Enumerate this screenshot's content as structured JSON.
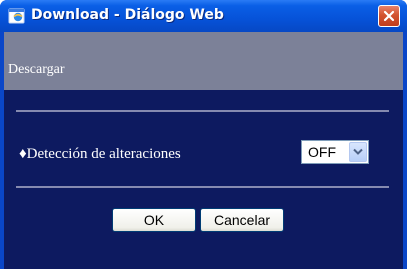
{
  "window": {
    "title": "Download - Diálogo Web",
    "close_icon": "close-icon",
    "app_icon": "browser-icon"
  },
  "section": {
    "title": "Descargar"
  },
  "field": {
    "label": "♦Detección de alteraciones",
    "select_value": "OFF",
    "select_icon": "chevron-down-icon"
  },
  "buttons": {
    "ok_label": "OK",
    "cancel_label": "Cancelar"
  },
  "colors": {
    "titlebar": "#0652d8",
    "client_background": "#0d1a60",
    "section_bar": "#7c8198",
    "close_button": "#d3532f"
  }
}
